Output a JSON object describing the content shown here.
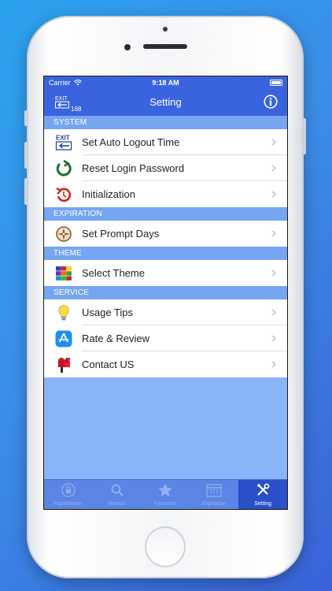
{
  "status_bar": {
    "carrier": "Carrier",
    "time": "9:18 AM"
  },
  "nav": {
    "title": "Setting",
    "count": "168"
  },
  "sections": {
    "system": "SYSTEM",
    "expiration": "EXPIRATION",
    "theme": "THEME",
    "service": "SERVICE"
  },
  "rows": {
    "auto_logout": "Set Auto Logout Time",
    "reset_password": "Reset Login Password",
    "initialization": "Initialization",
    "prompt_days": "Set Prompt Days",
    "select_theme": "Select Theme",
    "usage_tips": "Usage Tips",
    "rate_review": "Rate & Review",
    "contact_us": "Contact US"
  },
  "tabs": [
    {
      "label": "PassMaster",
      "icon": "lock-icon"
    },
    {
      "label": "Search",
      "icon": "search-icon"
    },
    {
      "label": "Favorites",
      "icon": "star-icon"
    },
    {
      "label": "Expiration",
      "icon": "calendar-icon"
    },
    {
      "label": "Setting",
      "icon": "tools-icon",
      "active": true
    }
  ],
  "colors": {
    "accent": "#3a64df",
    "section": "#76a5f2",
    "background": "#89b4f8",
    "tab_active": "#2a4fc9"
  }
}
